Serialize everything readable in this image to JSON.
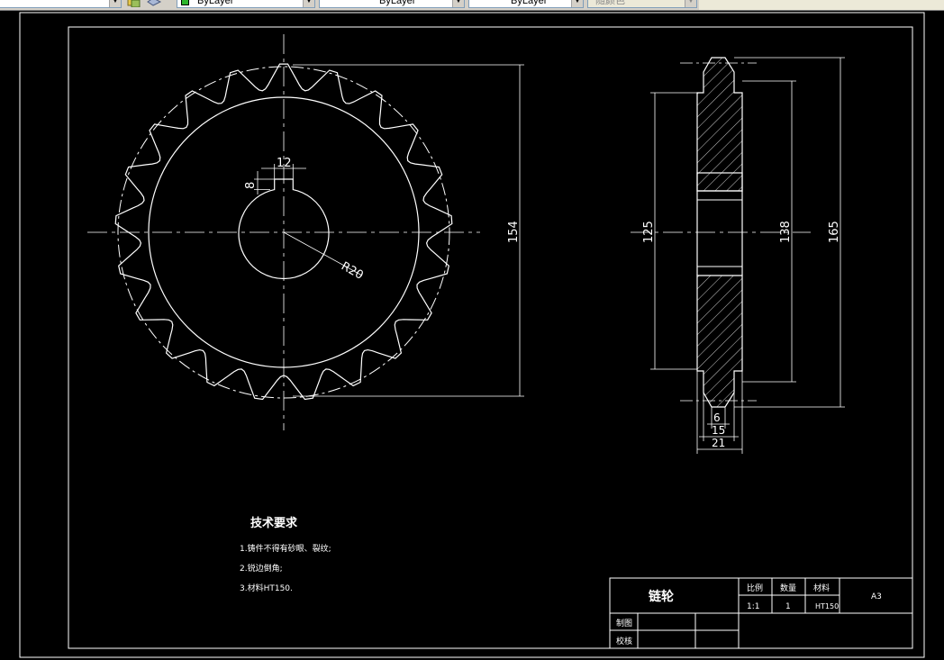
{
  "toolbar": {
    "layer_combo": "",
    "color_combo": "ByLayer",
    "linetype_combo": "ByLayer",
    "lineweight_combo": "ByLayer",
    "plotstyle_combo": "随颜色"
  },
  "drawing": {
    "dims": {
      "keyway_width": "12",
      "keyway_depth": "8",
      "bore_radius": "R20",
      "front_height": "154",
      "hub_diameter": "125",
      "pitch_diameter": "138",
      "outer_diameter": "165",
      "tooth_width": "6",
      "rim_width": "15",
      "hub_width": "21"
    },
    "tech_requirements": {
      "title": "技术要求",
      "items": [
        "1.铸件不得有砂眼、裂纹;",
        "2.锐边倒角;",
        "3.材料HT150."
      ]
    },
    "title_block": {
      "part_name": "链轮",
      "scale_label": "比例",
      "scale_value": "1:1",
      "qty_label": "数量",
      "qty_value": "1",
      "material_label": "材料",
      "material_value": "HT150",
      "sheet_size": "A3",
      "drawn_label": "制图",
      "checked_label": "校核"
    },
    "colors": {
      "background": "#000000",
      "lines": "#ffffff",
      "toolbar": "#d4d0c8"
    }
  }
}
